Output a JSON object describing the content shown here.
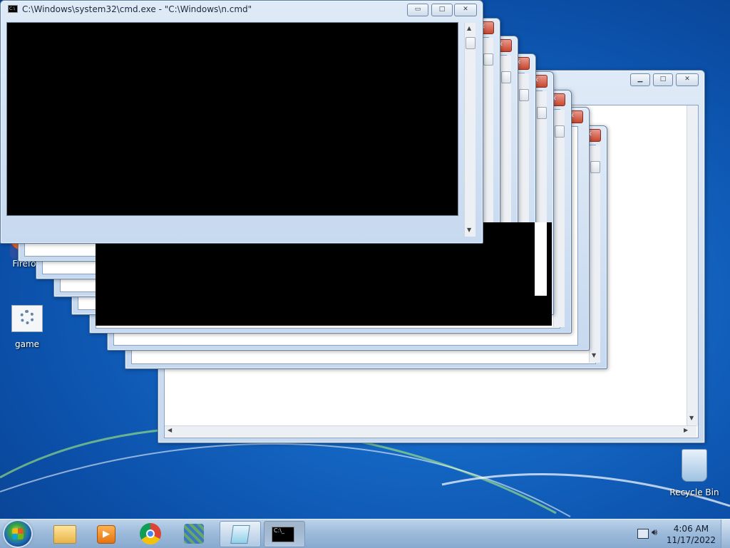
{
  "cmd_window": {
    "title": "C:\\Windows\\system32\\cmd.exe - \"C:\\Windows\\n.cmd\"",
    "controls": {
      "minimize": "▭",
      "maximize": "□",
      "close": "✕"
    }
  },
  "desktop_icons": {
    "firefox_label": "Firefo",
    "game_label": "game",
    "recycle_bin_label": "Recycle Bin"
  },
  "taskbar": {
    "pinned": [
      "windows-explorer-icon",
      "media-player-icon",
      "chrome-icon",
      "game-icon"
    ],
    "running": [
      "notepad-icon",
      "cmd-icon"
    ],
    "clock_time": "4:06 AM",
    "clock_date": "11/17/2022"
  },
  "colors": {
    "desktop_blue": "#1467c4",
    "window_frame": "#c7d9ef",
    "close_red": "#c9472f",
    "taskbar": "#9ebbdb"
  }
}
